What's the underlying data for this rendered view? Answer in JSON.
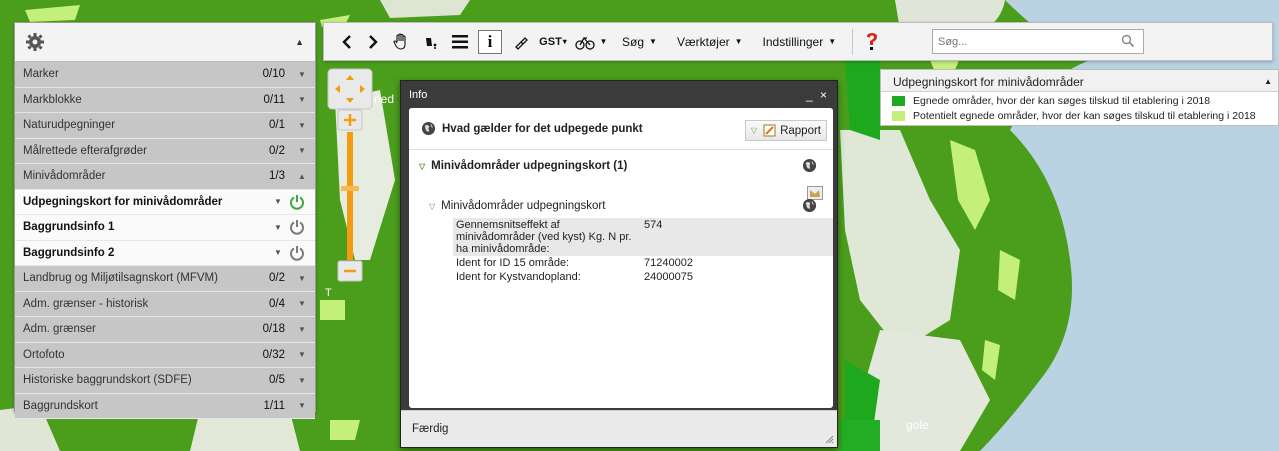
{
  "layers": [
    {
      "name": "Marker",
      "count": "0/10",
      "active": false
    },
    {
      "name": "Markblokke",
      "count": "0/11",
      "active": false
    },
    {
      "name": "Naturudpegninger",
      "count": "0/1",
      "active": false
    },
    {
      "name": "Målrettede efterafgrøder",
      "count": "0/2",
      "active": false
    },
    {
      "name": "Minivådområder",
      "count": "1/3",
      "active": false,
      "expanded": true
    },
    {
      "name": "Udpegningskort for minivådområder",
      "count": "",
      "active": true,
      "on": true
    },
    {
      "name": "Baggrundsinfo 1",
      "count": "",
      "active": true,
      "on": false
    },
    {
      "name": "Baggrundsinfo 2",
      "count": "",
      "active": true,
      "on": false
    },
    {
      "name": "Landbrug og Miljøtilsagnskort (MFVM)",
      "count": "0/2",
      "active": false
    },
    {
      "name": "Adm. grænser - historisk",
      "count": "0/4",
      "active": false
    },
    {
      "name": "Adm. grænser",
      "count": "0/18",
      "active": false
    },
    {
      "name": "Ortofoto",
      "count": "0/32",
      "active": false
    },
    {
      "name": "Historiske baggrundskort (SDFE)",
      "count": "0/5",
      "active": false
    },
    {
      "name": "Baggrundskort",
      "count": "1/11",
      "active": false
    }
  ],
  "toolbar": {
    "gst_label": "GST",
    "search_menu": "Søg",
    "tools_menu": "Værktøjer",
    "settings_menu": "Indstillinger",
    "search_placeholder": "Søg..."
  },
  "info": {
    "title": "Info",
    "window_controls": "_ ×",
    "question": "Hvad gælder for det udpegede punkt",
    "report_label": "Rapport",
    "section_title": "Minivådområder udpegningskort (1)",
    "subsection_title": "Minivådområder udpegningskort",
    "attributes": [
      {
        "key": "Gennemsnitseffekt af minivådområder (ved kyst) Kg. N pr. ha minivådområde:",
        "value": "574"
      },
      {
        "key": "Ident for ID 15 område:",
        "value": "71240002"
      },
      {
        "key": "Ident for Kystvandopland:",
        "value": "24000075"
      }
    ],
    "footer": "Færdig"
  },
  "legend": {
    "title": "Udpegningskort for minivådområder",
    "items": [
      {
        "label": "Egnede områder, hvor der kan søges tilskud til etablering i 2018",
        "color": "#1ea81e"
      },
      {
        "label": "Potentielt egnede områder, hvor der kan søges tilskud til etablering i 2018",
        "color": "#c4f07a"
      }
    ]
  },
  "map_labels": {
    "label_1": "ned",
    "label_2": "T",
    "label_3": "gole"
  },
  "colors": {
    "dark_green": "#3f9a16",
    "bright_green": "#1ea81e",
    "light_green": "#c4f07a",
    "water": "#b9d3e3",
    "power_on": "#3da83d",
    "power_off": "#7a7a7a",
    "zoom_orange": "#f39c12"
  }
}
